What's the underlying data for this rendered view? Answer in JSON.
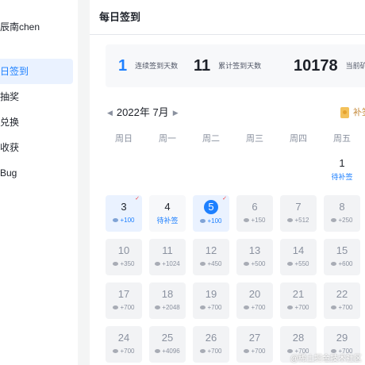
{
  "sidebar": {
    "user": "辰南chen",
    "items": [
      {
        "label": "日签到",
        "active": true
      },
      {
        "label": "抽奖",
        "active": false
      },
      {
        "label": "兑换",
        "active": false
      },
      {
        "label": "收获",
        "active": false
      },
      {
        "label": "Bug",
        "active": false
      }
    ]
  },
  "header": {
    "title": "每日签到"
  },
  "stats": {
    "streak": {
      "value": "1",
      "label": "连续签到天数"
    },
    "total": {
      "value": "11",
      "label": "累计签到天数"
    },
    "ore": {
      "value": "10178",
      "label": "当前矿"
    }
  },
  "calendar": {
    "month_label": "2022年 7月",
    "prev_arrow": "◀",
    "next_arrow": "▶",
    "makeup_label": "补签",
    "weekdays": [
      "周日",
      "周一",
      "周二",
      "周三",
      "周四",
      "周五"
    ],
    "days": [
      {
        "day": "1",
        "reward": "待补签",
        "state": "todo"
      },
      {
        "day": "3",
        "reward": "+100",
        "state": "signed",
        "check": "✓"
      },
      {
        "day": "4",
        "reward": "待补签",
        "state": "todo"
      },
      {
        "day": "5",
        "reward": "+100",
        "state": "today",
        "check": "✓"
      },
      {
        "day": "6",
        "reward": "+150",
        "state": "future"
      },
      {
        "day": "7",
        "reward": "+512",
        "state": "future"
      },
      {
        "day": "8",
        "reward": "+250",
        "state": "future"
      },
      {
        "day": "10",
        "reward": "+350",
        "state": "future"
      },
      {
        "day": "11",
        "reward": "+1024",
        "state": "future"
      },
      {
        "day": "12",
        "reward": "+450",
        "state": "future"
      },
      {
        "day": "13",
        "reward": "+500",
        "state": "future"
      },
      {
        "day": "14",
        "reward": "+550",
        "state": "future"
      },
      {
        "day": "15",
        "reward": "+600",
        "state": "future"
      },
      {
        "day": "17",
        "reward": "+700",
        "state": "future"
      },
      {
        "day": "18",
        "reward": "+2048",
        "state": "future"
      },
      {
        "day": "19",
        "reward": "+700",
        "state": "future"
      },
      {
        "day": "20",
        "reward": "+700",
        "state": "future"
      },
      {
        "day": "21",
        "reward": "+700",
        "state": "future"
      },
      {
        "day": "22",
        "reward": "+700",
        "state": "future"
      },
      {
        "day": "24",
        "reward": "+700",
        "state": "future"
      },
      {
        "day": "25",
        "reward": "+4096",
        "state": "future"
      },
      {
        "day": "26",
        "reward": "+700",
        "state": "future"
      },
      {
        "day": "27",
        "reward": "+700",
        "state": "future"
      },
      {
        "day": "28",
        "reward": "+700",
        "state": "future"
      },
      {
        "day": "29",
        "reward": "+700",
        "state": "future"
      }
    ]
  },
  "watermark": "@稀土掘金技术社区",
  "colors": {
    "accent": "#1e80ff",
    "signed_bg": "#eaf2ff",
    "cell_bg": "#f2f3f5",
    "makeup": "#c58a3b",
    "check": "#f53f3f"
  }
}
